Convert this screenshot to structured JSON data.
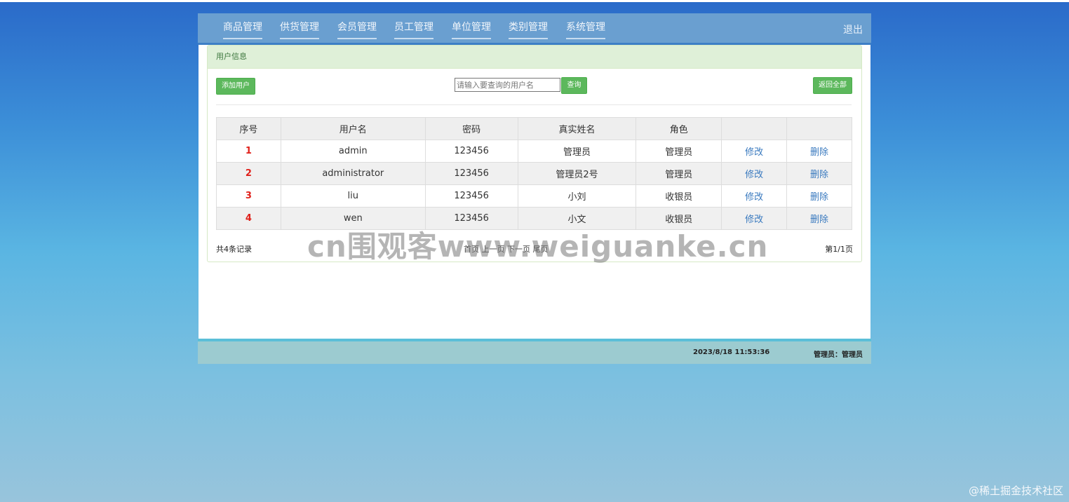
{
  "nav": {
    "items": [
      "商品管理",
      "供货管理",
      "会员管理",
      "员工管理",
      "单位管理",
      "类别管理",
      "系统管理"
    ],
    "logout": "退出"
  },
  "panel": {
    "title": "用户信息",
    "add_button": "添加用户",
    "search_placeholder": "请输入要查询的用户名",
    "search_button": "查询",
    "reset_button": "返回全部"
  },
  "table": {
    "headers": [
      "序号",
      "用户名",
      "密码",
      "真实姓名",
      "角色",
      "",
      ""
    ],
    "rows": [
      {
        "idx": "1",
        "username": "admin",
        "password": "123456",
        "realname": "管理员",
        "role": "管理员",
        "edit": "修改",
        "delete": "删除"
      },
      {
        "idx": "2",
        "username": "administrator",
        "password": "123456",
        "realname": "管理员2号",
        "role": "管理员",
        "edit": "修改",
        "delete": "删除"
      },
      {
        "idx": "3",
        "username": "liu",
        "password": "123456",
        "realname": "小刘",
        "role": "收银员",
        "edit": "修改",
        "delete": "删除"
      },
      {
        "idx": "4",
        "username": "wen",
        "password": "123456",
        "realname": "小文",
        "role": "收银员",
        "edit": "修改",
        "delete": "删除"
      }
    ]
  },
  "footer": {
    "total": "共4条记录",
    "pager": "首页 上一页 下一页 尾页",
    "page": "第1/1页"
  },
  "status": {
    "datetime": "2023/8/18 11:53:36",
    "user": "管理员：管理员"
  },
  "watermark": "cn围观客www.weiguanke.cn",
  "corner_mark": "@稀土掘金技术社区"
}
